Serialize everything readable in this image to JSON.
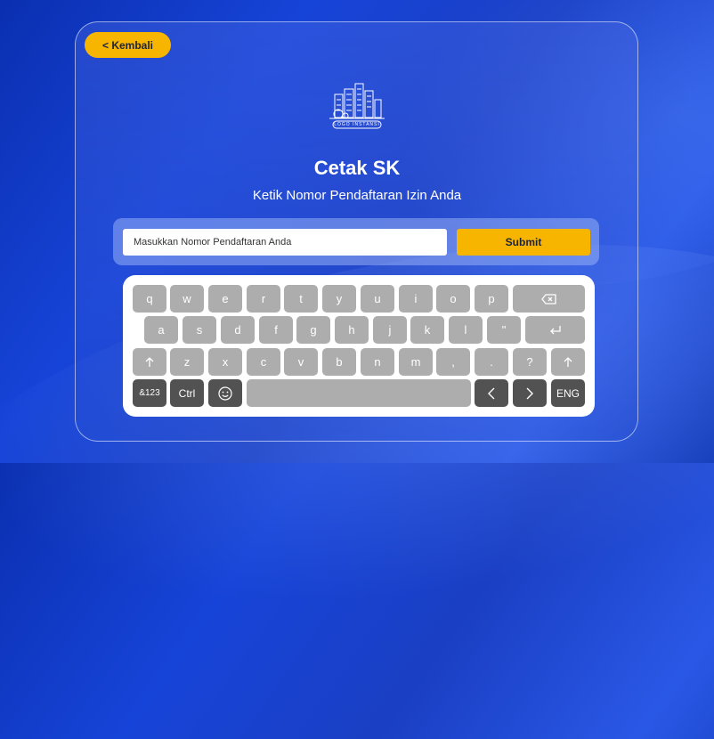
{
  "header": {
    "back_label": "< Kembali"
  },
  "logo": {
    "caption": "LOGO INSTANSI"
  },
  "main": {
    "title": "Cetak SK",
    "subtitle": "Ketik Nomor Pendaftaran Izin Anda"
  },
  "form": {
    "placeholder": "Masukkan Nomor Pendaftaran Anda",
    "value": "",
    "submit_label": "Submit"
  },
  "keyboard": {
    "row1": [
      "q",
      "w",
      "e",
      "r",
      "t",
      "y",
      "u",
      "i",
      "o",
      "p"
    ],
    "row1_backspace_icon": "backspace-icon",
    "row2": [
      "a",
      "s",
      "d",
      "f",
      "g",
      "h",
      "j",
      "k",
      "l",
      "\""
    ],
    "row2_enter_icon": "enter-icon",
    "row3_left_shift_icon": "shift-icon",
    "row3": [
      "z",
      "x",
      "c",
      "v",
      "b",
      "n",
      "m",
      ",",
      ".",
      "?"
    ],
    "row3_right_shift_icon": "shift-icon",
    "row4": {
      "symbols": "&123",
      "ctrl": "Ctrl",
      "emoji_icon": "emoji-icon",
      "left_arrow_icon": "chevron-left-icon",
      "right_arrow_icon": "chevron-right-icon",
      "lang": "ENG"
    },
    "colors": {
      "key_light": "#adadad",
      "key_dark": "#525252"
    }
  },
  "colors": {
    "accent": "#f7b500",
    "background": "#1744d8"
  }
}
